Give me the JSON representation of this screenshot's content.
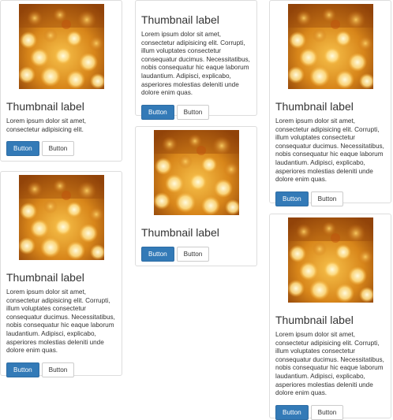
{
  "cards": [
    {
      "title": "Thumbnail label",
      "text": "Lorem ipsum dolor sit amet, consectetur adipisicing elit.",
      "primary_label": "Button",
      "default_label": "Button",
      "has_image": true
    },
    {
      "title": "Thumbnail label",
      "text": "Lorem ipsum dolor sit amet, consectetur adipisicing elit. Corrupti, illum voluptates consectetur consequatur ducimus. Necessitatibus, nobis consequatur hic eaque laborum laudantium. Adipisci, explicabo, asperiores molestias deleniti unde dolore enim quas.",
      "primary_label": "Button",
      "default_label": "Button",
      "has_image": true
    },
    {
      "title": "Thumbnail label",
      "text": "Lorem ipsum dolor sit amet, consectetur adipisicing elit. Corrupti, illum voluptates consectetur consequatur ducimus. Necessitatibus, nobis consequatur hic eaque laborum laudantium. Adipisci, explicabo, asperiores molestias deleniti unde dolore enim quas.",
      "primary_label": "Button",
      "default_label": "Button",
      "has_image": false
    },
    {
      "title": "Thumbnail label",
      "text": "",
      "primary_label": "Button",
      "default_label": "Button",
      "has_image": true
    },
    {
      "title": "Thumbnail label",
      "text": "Lorem ipsum dolor sit amet, consectetur adipisicing elit. Corrupti, illum voluptates consectetur consequatur ducimus. Necessitatibus, nobis consequatur hic eaque laborum laudantium. Adipisci, explicabo, asperiores molestias deleniti unde dolore enim quas.",
      "primary_label": "Button",
      "default_label": "Button",
      "has_image": true
    },
    {
      "title": "Thumbnail label",
      "text": "Lorem ipsum dolor sit amet, consectetur adipisicing elit. Corrupti, illum voluptates consectetur consequatur ducimus. Necessitatibus, nobis consequatur hic eaque laborum laudantium. Adipisci, explicabo, asperiores molestias deleniti unde dolore enim quas.",
      "primary_label": "Button",
      "default_label": "Button",
      "has_image": true
    }
  ],
  "colors": {
    "primary": "#337ab7",
    "border": "#dddddd",
    "text": "#333333"
  },
  "icons": {
    "thumbnail": "bokeh-lights-image"
  }
}
